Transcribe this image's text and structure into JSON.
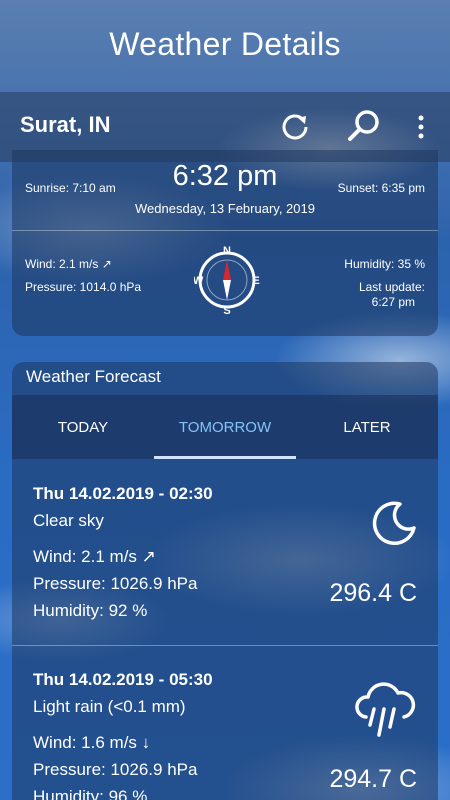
{
  "header": {
    "title": "Weather Details"
  },
  "app_bar": {
    "city": "Surat, IN",
    "actions": [
      "refresh-icon",
      "search-icon",
      "more-vert-icon"
    ]
  },
  "current": {
    "sunrise": "Sunrise: 7:10 am",
    "time": "6:32 pm",
    "sunset": "Sunset: 6:35 pm",
    "date": "Wednesday, 13 February, 2019",
    "wind": "Wind: 2.1 m/s ↗",
    "pressure": "Pressure: 1014.0 hPa",
    "humidity": "Humidity: 35 %",
    "last_update_label": "Last update:",
    "last_update_time": "6:27 pm",
    "compass_labels": {
      "n": "N",
      "s": "S",
      "e": "E",
      "w": "W"
    }
  },
  "forecast": {
    "title": "Weather Forecast",
    "tabs": [
      "TODAY",
      "TOMORROW",
      "LATER"
    ],
    "selected_tab": "TOMORROW",
    "entries": [
      {
        "datetime": "Thu 14.02.2019 - 02:30",
        "condition": "Clear sky",
        "wind": "Wind: 2.1 m/s ↗",
        "pressure": "Pressure: 1026.9 hPa",
        "humidity": "Humidity: 92 %",
        "temp": "296.4 C",
        "icon": "moon-icon"
      },
      {
        "datetime": "Thu 14.02.2019 - 05:30",
        "condition": "Light rain (<0.1 mm)",
        "wind": "Wind: 1.6 m/s ↓",
        "pressure": "Pressure: 1026.9 hPa",
        "humidity": "Humidity: 96 %",
        "temp": "294.7 C",
        "icon": "rain-cloud-icon"
      }
    ]
  },
  "colors": {
    "accent_tab": "#86c3f5",
    "compass_needle": "#d9262c"
  }
}
